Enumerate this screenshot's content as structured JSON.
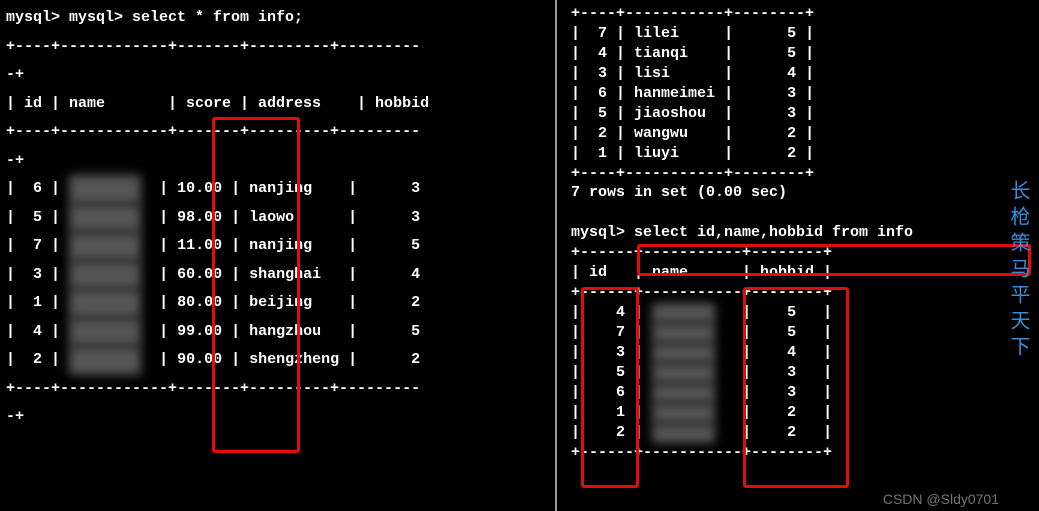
{
  "left": {
    "prompt": "mysql> mysql> select * from info;",
    "sep_top": "+----+------------+-------+---------+---------",
    "sep_mid": "-+",
    "header": "| id | name       | score | address    | hobbid",
    "rows": [
      {
        "id": "6",
        "score": "10.00",
        "address": "nanjing",
        "hobbid": "3"
      },
      {
        "id": "5",
        "score": "98.00",
        "address": "laowo",
        "hobbid": "3"
      },
      {
        "id": "7",
        "score": "11.00",
        "address": "nanjing",
        "hobbid": "5"
      },
      {
        "id": "3",
        "score": "60.00",
        "address": "shanghai",
        "hobbid": "4"
      },
      {
        "id": "1",
        "score": "80.00",
        "address": "beijing",
        "hobbid": "2"
      },
      {
        "id": "4",
        "score": "99.00",
        "address": "hangzhou",
        "hobbid": "5"
      },
      {
        "id": "2",
        "score": "90.00",
        "address": "shengzheng",
        "hobbid": "2"
      }
    ]
  },
  "right": {
    "top_rows": [
      {
        "id": "7",
        "name": "lilei",
        "hobbid": "5"
      },
      {
        "id": "4",
        "name": "tianqi",
        "hobbid": "5"
      },
      {
        "id": "3",
        "name": "lisi",
        "hobbid": "4"
      },
      {
        "id": "6",
        "name": "hanmeimei",
        "hobbid": "3"
      },
      {
        "id": "5",
        "name": "jiaoshou",
        "hobbid": "3"
      },
      {
        "id": "2",
        "name": "wangwu",
        "hobbid": "2"
      },
      {
        "id": "1",
        "name": "liuyi",
        "hobbid": "2"
      }
    ],
    "top_sep": "+----+-----------+--------+",
    "rows_msg": "7 rows in set (0.00 sec)",
    "prompt2": "mysql> select id,name,hobbid from info ",
    "header2": "| id   | name      | hobbid |",
    "sep2": "+------+-----------+--------+",
    "bottom_rows": [
      {
        "id": "4",
        "hobbid": "5"
      },
      {
        "id": "7",
        "hobbid": "5"
      },
      {
        "id": "3",
        "hobbid": "4"
      },
      {
        "id": "5",
        "hobbid": "3"
      },
      {
        "id": "6",
        "hobbid": "3"
      },
      {
        "id": "1",
        "hobbid": "2"
      },
      {
        "id": "2",
        "hobbid": "2"
      }
    ]
  },
  "watermark_v": "长枪策马平天下",
  "watermark_h": "CSDN @Sldy0701"
}
